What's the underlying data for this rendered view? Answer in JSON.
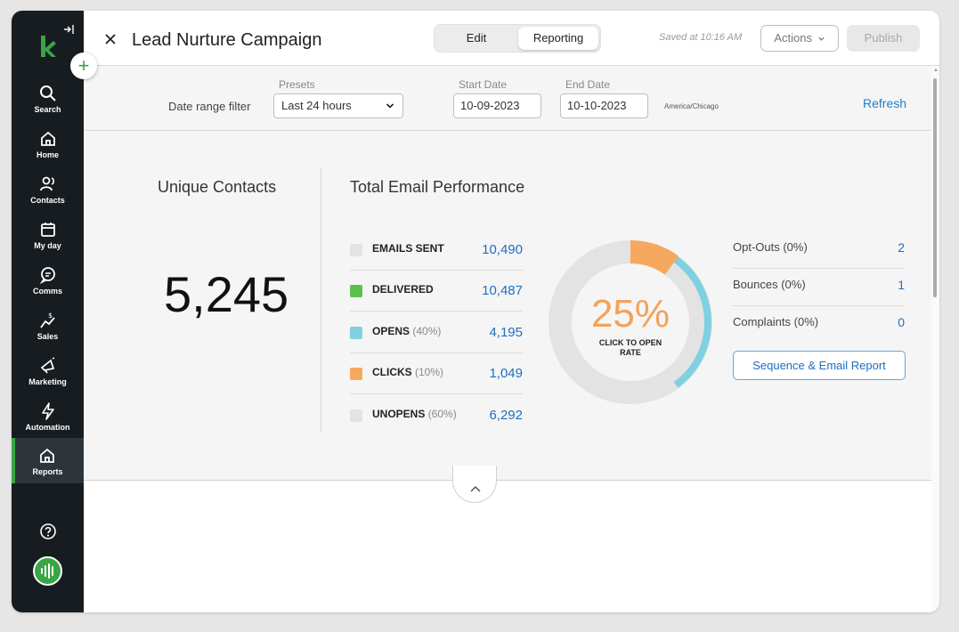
{
  "sidebar": {
    "items": [
      {
        "label": "Search",
        "icon": "search-icon"
      },
      {
        "label": "Home",
        "icon": "home-icon"
      },
      {
        "label": "Contacts",
        "icon": "contacts-icon"
      },
      {
        "label": "My day",
        "icon": "calendar-icon"
      },
      {
        "label": "Comms",
        "icon": "chat-icon"
      },
      {
        "label": "Sales",
        "icon": "sales-icon"
      },
      {
        "label": "Marketing",
        "icon": "megaphone-icon"
      },
      {
        "label": "Automation",
        "icon": "lightning-icon"
      },
      {
        "label": "Reports",
        "icon": "reports-icon"
      }
    ],
    "active": "Reports",
    "add_label": "+",
    "accent_color": "#3aa545"
  },
  "header": {
    "title": "Lead Nurture Campaign",
    "tabs": [
      "Edit",
      "Reporting"
    ],
    "active_tab": "Reporting",
    "saved_text": "Saved at 10:16 AM",
    "actions_label": "Actions",
    "publish_label": "Publish"
  },
  "filter": {
    "label": "Date range filter",
    "presets_label": "Presets",
    "preset_value": "Last 24 hours",
    "start_label": "Start Date",
    "start_value": "10-09-2023",
    "end_label": "End Date",
    "end_value": "10-10-2023",
    "timezone": "America/Chicago",
    "refresh_label": "Refresh"
  },
  "contacts": {
    "title": "Unique Contacts",
    "value": "5,245"
  },
  "performance": {
    "title": "Total Email Performance",
    "metrics": [
      {
        "label": "EMAILS SENT",
        "pct": "",
        "value": "10,490",
        "color": "#e3e3e3"
      },
      {
        "label": "DELIVERED",
        "pct": "",
        "value": "10,487",
        "color": "#5ec04a"
      },
      {
        "label": "OPENS",
        "pct": "(40%)",
        "value": "4,195",
        "color": "#7fd0e0"
      },
      {
        "label": "CLICKS",
        "pct": "(10%)",
        "value": "1,049",
        "color": "#f6a95e"
      },
      {
        "label": "UNOPENS",
        "pct": "(60%)",
        "value": "6,292",
        "color": "#e3e3e3"
      }
    ],
    "donut": {
      "percent": "25%",
      "caption_line1": "CLICK TO OPEN",
      "caption_line2": "RATE",
      "open_fraction": 0.4,
      "click_fraction": 0.1,
      "track_color": "#e3e3e3",
      "open_color": "#7fd0e0",
      "click_color": "#f6a95e"
    }
  },
  "stats": [
    {
      "label": "Opt-Outs (0%)",
      "value": "2"
    },
    {
      "label": "Bounces (0%)",
      "value": "1"
    },
    {
      "label": "Complaints (0%)",
      "value": "0"
    }
  ],
  "report_button": "Sequence & Email Report"
}
